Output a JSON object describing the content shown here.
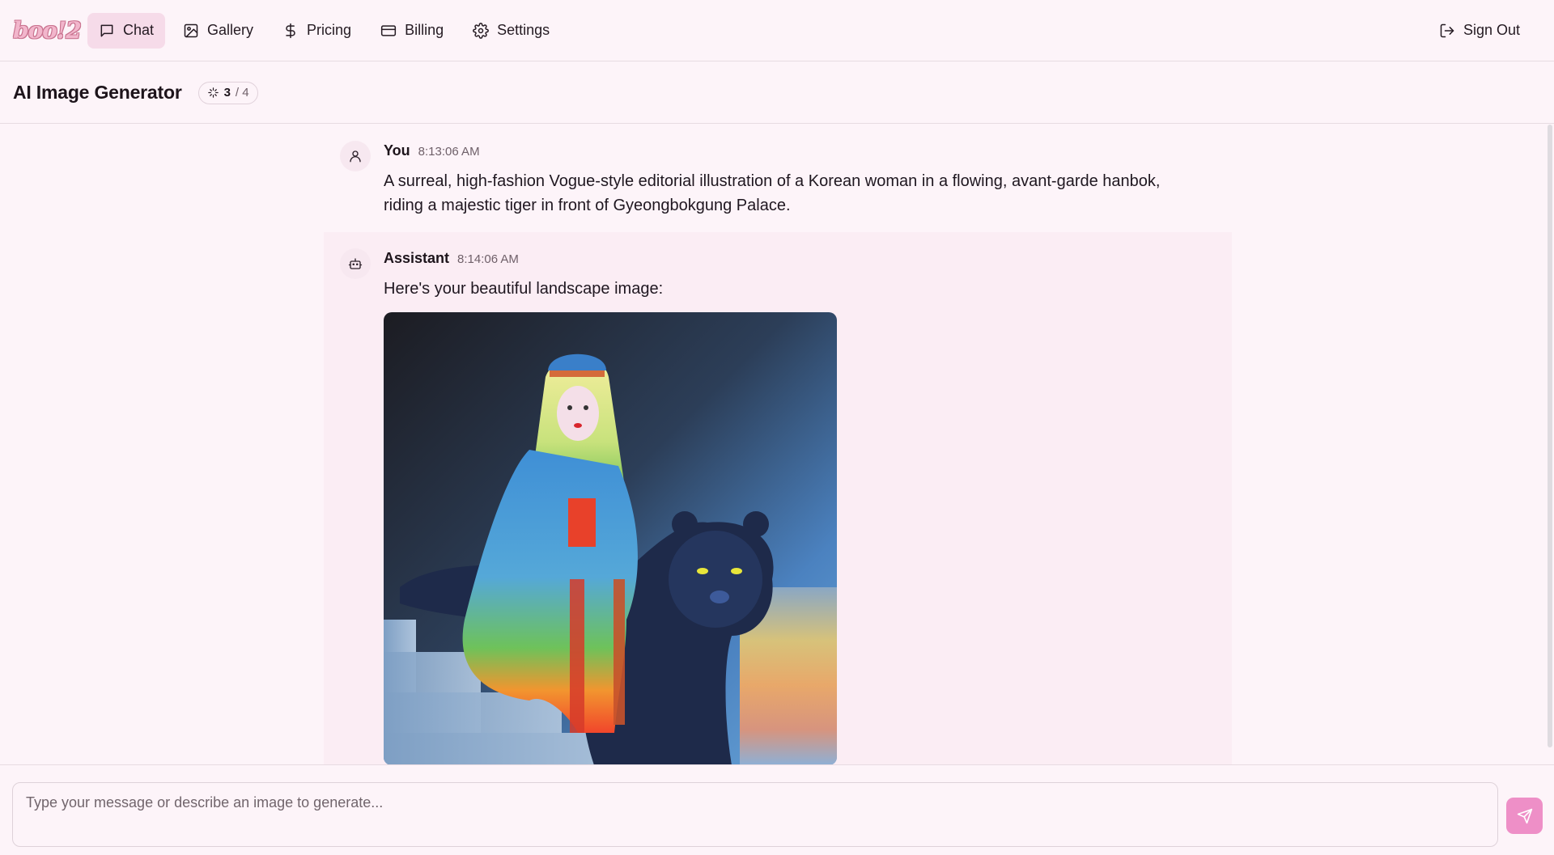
{
  "nav": {
    "logo": "boo!2",
    "items": [
      {
        "label": "Chat",
        "icon": "chat-bubble-icon",
        "active": true
      },
      {
        "label": "Gallery",
        "icon": "image-icon",
        "active": false
      },
      {
        "label": "Pricing",
        "icon": "dollar-icon",
        "active": false
      },
      {
        "label": "Billing",
        "icon": "credit-card-icon",
        "active": false
      },
      {
        "label": "Settings",
        "icon": "gear-icon",
        "active": false
      }
    ],
    "signout_label": "Sign Out"
  },
  "header": {
    "title": "AI Image Generator",
    "credits_used": "3",
    "credits_total": "/ 4"
  },
  "messages": [
    {
      "role": "user",
      "sender": "You",
      "time": "8:13:06 AM",
      "text": "A surreal, high-fashion Vogue-style editorial illustration of a Korean woman in a flowing, avant-garde hanbok, riding a majestic tiger in front of Gyeongbokgung Palace."
    },
    {
      "role": "assistant",
      "sender": "Assistant",
      "time": "8:14:06 AM",
      "text": "Here's your beautiful landscape image:"
    }
  ],
  "composer": {
    "placeholder": "Type your message or describe an image to generate..."
  },
  "colors": {
    "background": "#fdf4f9",
    "active_nav": "#f6dbe9",
    "assistant_bg": "#fbedf4",
    "send_button": "#ee8fc7"
  }
}
